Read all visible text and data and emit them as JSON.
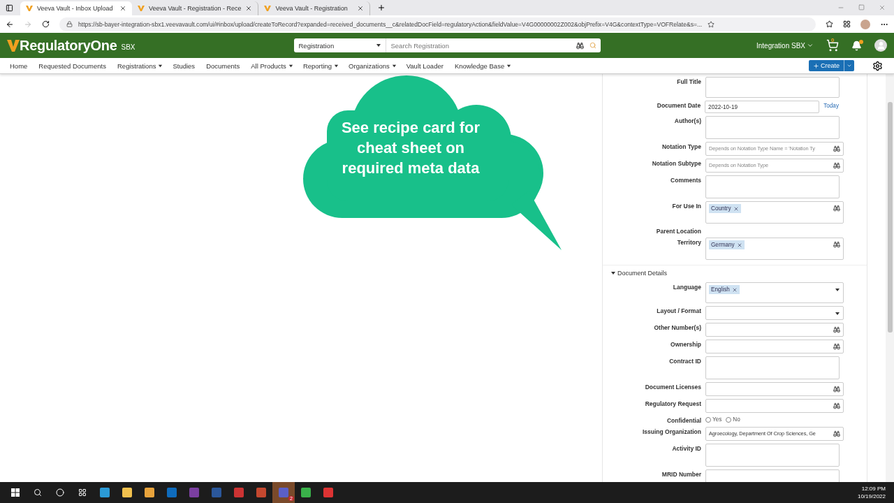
{
  "browser": {
    "tabs": [
      {
        "title": "Veeva Vault - Inbox Upload",
        "selected": true
      },
      {
        "title": "Veeva Vault - Registration - Rece",
        "selected": false
      },
      {
        "title": "Veeva Vault - Registration",
        "selected": false
      }
    ],
    "url": "https://sb-bayer-integration-sbx1.veevavault.com/ui/#inbox/upload/createToRecord?expanded=received_documents__c&relatedDocField=regulatoryAction&fieldValue=V4G00000002Z002&objPrefix=V4G&contextType=VOFRelate&s=..."
  },
  "header": {
    "logo": "RegulatoryOne",
    "env": "SBX",
    "search_scope": "Registration",
    "search_placeholder": "Search Registration",
    "vault": "Integration SBX",
    "cart_count": "0",
    "has_alert": true
  },
  "nav": {
    "items": [
      {
        "label": "Home",
        "dropdown": false
      },
      {
        "label": "Requested Documents",
        "dropdown": false
      },
      {
        "label": "Registrations",
        "dropdown": true
      },
      {
        "label": "Studies",
        "dropdown": false
      },
      {
        "label": "Documents",
        "dropdown": false
      },
      {
        "label": "All Products",
        "dropdown": true
      },
      {
        "label": "Reporting",
        "dropdown": true
      },
      {
        "label": "Organizations",
        "dropdown": true
      },
      {
        "label": "Vault Loader",
        "dropdown": false
      },
      {
        "label": "Knowledge Base",
        "dropdown": true
      }
    ],
    "create": "Create"
  },
  "callout": "See recipe card for cheat sheet on required meta data",
  "form": [
    {
      "kind": "textarea",
      "label": "Full Title"
    },
    {
      "kind": "date",
      "label": "Document Date",
      "value": "2022-10-19",
      "link": "Today"
    },
    {
      "kind": "textarea",
      "label": "Author(s)"
    },
    {
      "kind": "lookup",
      "label": "Notation Type",
      "placeholder": "Depends on Notation Type Name = 'Notation Ty"
    },
    {
      "kind": "lookup",
      "label": "Notation Subtype",
      "placeholder": "Depends on Notation Type"
    },
    {
      "kind": "textarea",
      "label": "Comments"
    },
    {
      "kind": "tags",
      "label": "For Use In",
      "tags": [
        "Country"
      ]
    },
    {
      "kind": "label",
      "label": "Parent Location"
    },
    {
      "kind": "tags",
      "label": "Territory",
      "tags": [
        "Germany"
      ]
    },
    {
      "kind": "section",
      "label": "Document Details",
      "expanded": true
    },
    {
      "kind": "select",
      "label": "Language",
      "tags": [
        "English"
      ]
    },
    {
      "kind": "select",
      "label": "Layout / Format"
    },
    {
      "kind": "lookup",
      "label": "Other Number(s)"
    },
    {
      "kind": "lookup",
      "label": "Ownership"
    },
    {
      "kind": "textarea",
      "label": "Contract ID"
    },
    {
      "kind": "lookup",
      "label": "Document Licenses"
    },
    {
      "kind": "lookup",
      "label": "Regulatory Request"
    },
    {
      "kind": "radio",
      "label": "Confidential",
      "options": [
        {
          "label": "Yes",
          "selected": false
        },
        {
          "label": "No",
          "selected": false
        }
      ]
    },
    {
      "kind": "lookup",
      "label": "Issuing Organization",
      "value": "Agroecology, Department Of Crop Sciences, Ge"
    },
    {
      "kind": "textarea",
      "label": "Activity ID"
    },
    {
      "kind": "textarea",
      "label": "MRID Number"
    }
  ],
  "taskbar": {
    "badge": "2",
    "time": "12:09 PM",
    "date": "10/19/2022"
  }
}
